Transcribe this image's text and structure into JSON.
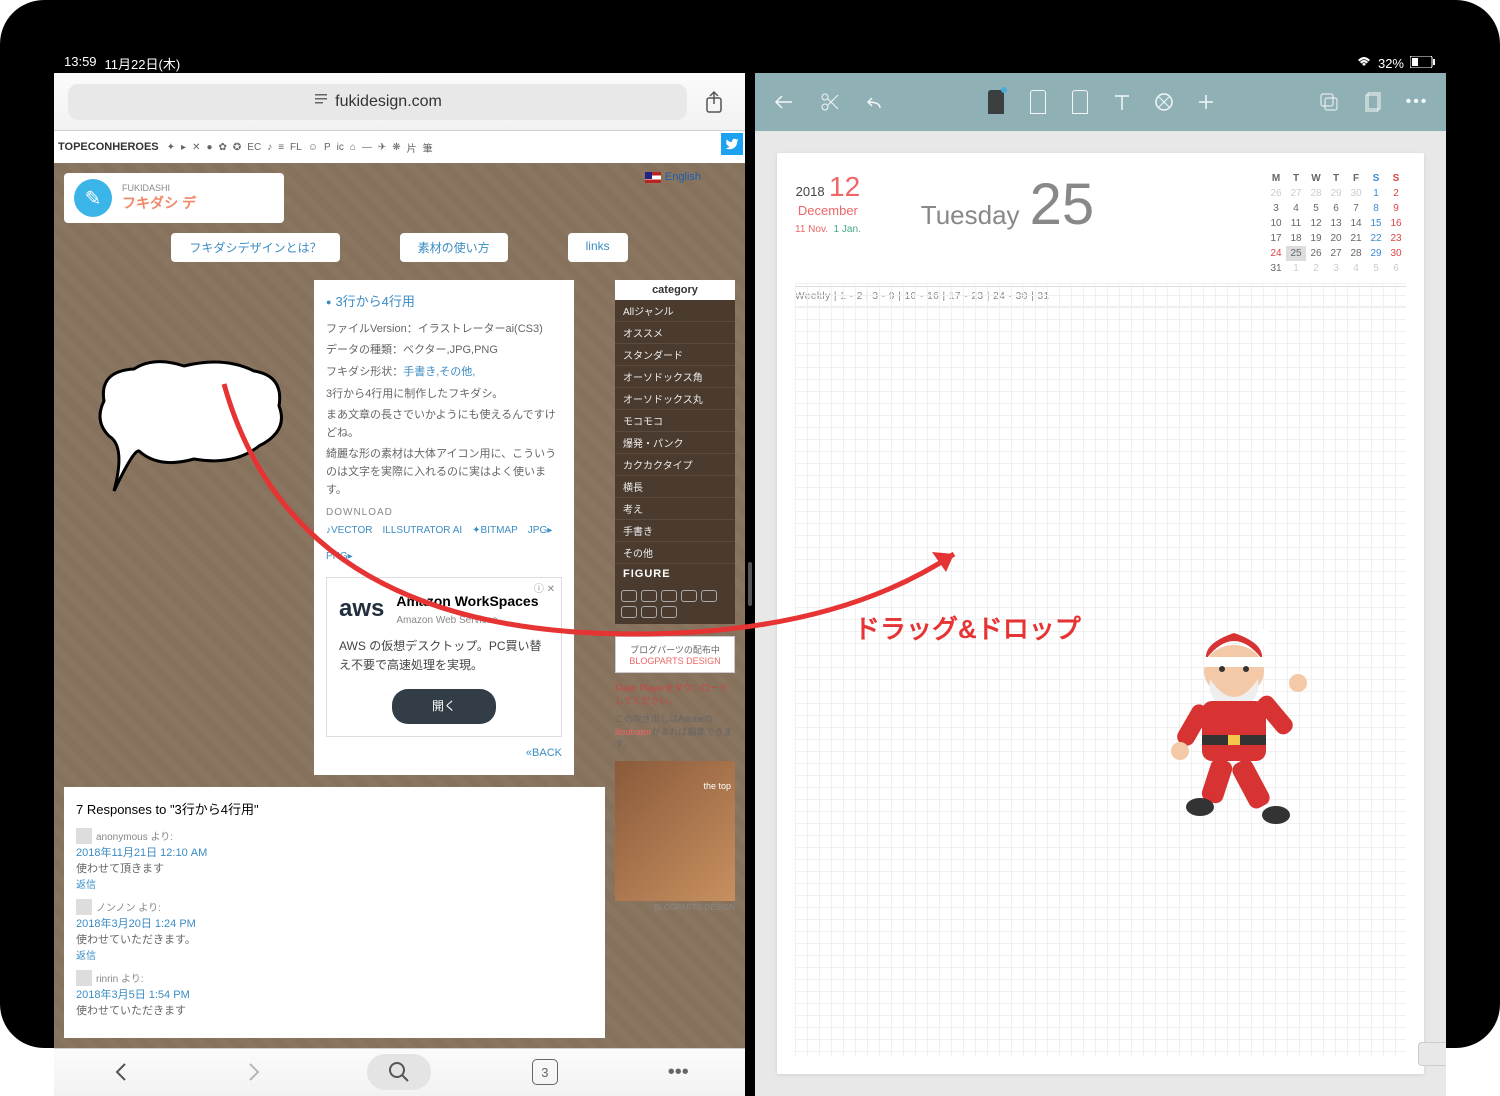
{
  "status": {
    "time": "13:59",
    "date": "11月22日(木)",
    "battery": "32%"
  },
  "safari": {
    "url": "fukidesign.com",
    "topecon": "TOPECONHEROES",
    "lang": "English",
    "tabs": [
      "フキダシデザインとは？",
      "素材の使い方",
      "links"
    ],
    "article": {
      "title": "3行から4行用",
      "line1": "ファイルVersion：イラストレーターai(CS3)",
      "line2": "データの種類：ベクター,JPG,PNG",
      "line3_pre": "フキダシ形状：",
      "line3_link": "手書き,その他,",
      "body1": "3行から4行用に制作したフキダシ。",
      "body2": "まあ文章の長さでいかようにも使えるんですけどね。",
      "body3": "綺麗な形の素材は大体アイコン用に、こういうのは文字を実際に入れるのに実はよく使います。",
      "download": "DOWNLOAD",
      "dl1": "VECTOR",
      "dl2": "ILLSUTRATOR AI",
      "dl3": "BITMAP",
      "dl4": "JPG",
      "dl5": "PNG"
    },
    "ad": {
      "brand": "aws",
      "title": "Amazon WorkSpaces",
      "sub": "Amazon Web Services",
      "desc": "AWS の仮想デスクトップ。PC買い替え不要で高速処理を実現。",
      "btn": "開く",
      "back": "«BACK"
    },
    "sidebar": {
      "cat_title": "category",
      "cats": [
        "Allジャンル",
        "オススメ",
        "スタンダード",
        "オーソドックス角",
        "オーソドックス丸",
        "モコモコ",
        "爆発・パンク",
        "カクカクタイプ",
        "横長",
        "考え",
        "手書き",
        "その他"
      ],
      "figure": "FIGURE",
      "bp1": "ブログパーツの配布中",
      "bp2": "BLOGPARTS DESIGN",
      "flash": "Flash Playerをダウンロードしてください。",
      "adobe_pre": "この吹き出しはAdobeの",
      "adobe_link": "illsutrator",
      "adobe_post": "があれば編集できます。",
      "top": "the top",
      "bpd": "BLOGPARTS DESIGN"
    },
    "comments": {
      "title": "7 Responses to \"3行から4行用\"",
      "items": [
        {
          "name": "anonymous より:",
          "date": "2018年11月21日 12:10 AM",
          "body": "使わせて頂きます",
          "reply": "返信"
        },
        {
          "name": "ノンノン より:",
          "date": "2018年3月20日 1:24 PM",
          "body": "使わせていただきます。",
          "reply": "返信"
        },
        {
          "name": "rinrin より:",
          "date": "2018年3月5日 1:54 PM",
          "body": "使わせていただきます",
          "reply": ""
        }
      ]
    },
    "tabcount": "3"
  },
  "notes": {
    "year": "2018",
    "mon": "12",
    "monlbl": "December",
    "nov": "11 Nov.",
    "jan": "1 Jan.",
    "weekday": "Tuesday",
    "day": "25",
    "dow": [
      "M",
      "T",
      "W",
      "T",
      "F",
      "S",
      "S"
    ],
    "weekly": "Weekly  |  1 - 2  |  3 - 9  |  10 - 16  |  17 - 23  |  24 - 30  |  31"
  },
  "annotation": "ドラッグ&ドロップ"
}
